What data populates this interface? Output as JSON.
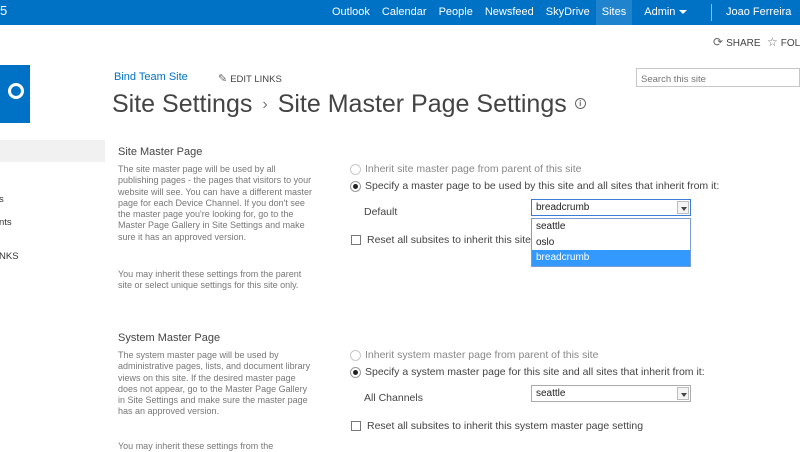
{
  "suite_bar": {
    "brand_fragment": "5",
    "nav": [
      "Outlook",
      "Calendar",
      "People",
      "Newsfeed",
      "SkyDrive",
      "Sites"
    ],
    "active_nav": "Sites",
    "admin_label": "Admin",
    "user_name": "Joao Ferreira"
  },
  "action_bar": {
    "share_label": "SHARE",
    "follow_label": "FOL"
  },
  "header": {
    "site_link": "Bind Team Site",
    "edit_links_label": "EDIT LINKS",
    "search_placeholder": "Search this site",
    "title_part1": "Site Settings",
    "title_separator": "›",
    "title_part2": "Site Master Page Settings"
  },
  "left_nav": {
    "items": [
      "s",
      "nts",
      "NKS"
    ]
  },
  "site_master": {
    "title": "Site Master Page",
    "description": "The site master page will be used by all publishing pages - the pages that visitors to your website will see. You can have a different master page for each Device Channel. If you don't see the master page you're looking for, go to the Master Page Gallery in Site Settings and make sure it has an approved version.",
    "description2": "You may inherit these settings from the parent site or select unique settings for this site only.",
    "radio_inherit": "Inherit site master page from parent of this site",
    "radio_specify": "Specify a master page to be used by this site and all sites that inherit from it:",
    "channel_label": "Default",
    "selected_value": "breadcrumb",
    "options": [
      "seattle",
      "oslo",
      "breadcrumb"
    ],
    "reset_label": "Reset all subsites to inherit this site"
  },
  "system_master": {
    "title": "System Master Page",
    "description": "The system master page will be used by administrative pages, lists, and document library views on this site. If the desired master page does not appear, go to the Master Page Gallery in Site Settings and make sure the master page has an approved version.",
    "description2": "You may inherit these settings from the",
    "radio_inherit": "Inherit system master page from parent of this site",
    "radio_specify": "Specify a system master page for this site and all sites that inherit from it:",
    "channel_label": "All Channels",
    "selected_value": "seattle",
    "reset_label": "Reset all subsites to inherit this system master page setting"
  },
  "colors": {
    "suite_bar": "#0072c6",
    "link": "#0072c6",
    "dropdown_highlight": "#3399ff"
  }
}
